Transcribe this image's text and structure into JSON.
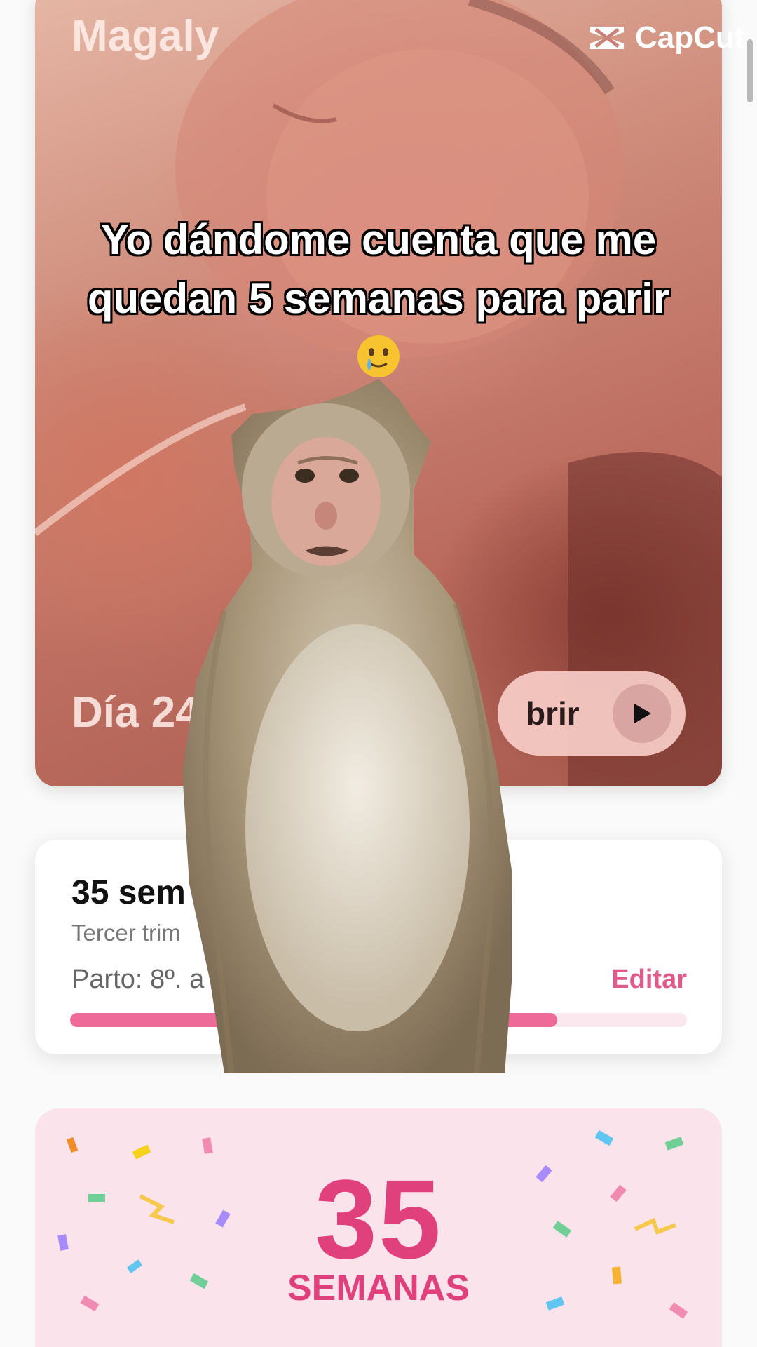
{
  "watermark": {
    "label": "CapCut",
    "icon": "capcut-logo-icon"
  },
  "hero": {
    "name": "Magaly",
    "day": "Día 24",
    "open_button_label": "brir",
    "play_icon": "play-icon"
  },
  "caption": {
    "line1": "Yo dándome cuenta que me",
    "line2": "quedan 5 semanas para parir",
    "emoji": "crying-smile-emoji"
  },
  "week_card": {
    "title": "35 sem",
    "subtitle": "Tercer trim",
    "due": "Parto: 8º. a",
    "edit_label": "Editar",
    "progress": 0.79,
    "accent": "#ee6a99"
  },
  "celebration": {
    "number": "35",
    "label": "SEMANAS",
    "accent": "#e0407c"
  },
  "overlay": {
    "sticker": "monkey-sticker"
  }
}
